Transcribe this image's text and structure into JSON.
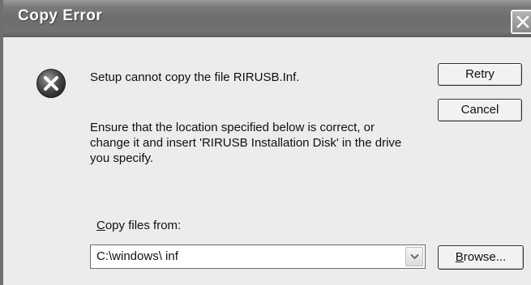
{
  "window": {
    "title": "Copy Error"
  },
  "dialog": {
    "message_line1": "Setup cannot copy the file RIRUSB.Inf.",
    "message_line2": "Ensure that the location specified below is correct, or change it and insert 'RIRUSB Installation Disk' in the drive you specify.",
    "icon": "error-icon"
  },
  "buttons": {
    "retry": "Retry",
    "cancel": "Cancel",
    "browse_mnemonic": "B",
    "browse_rest": "rowse..."
  },
  "copy_from": {
    "label_mnemonic": "C",
    "label_rest": "opy files from:",
    "value": "C:\\windows\\ inf"
  }
}
